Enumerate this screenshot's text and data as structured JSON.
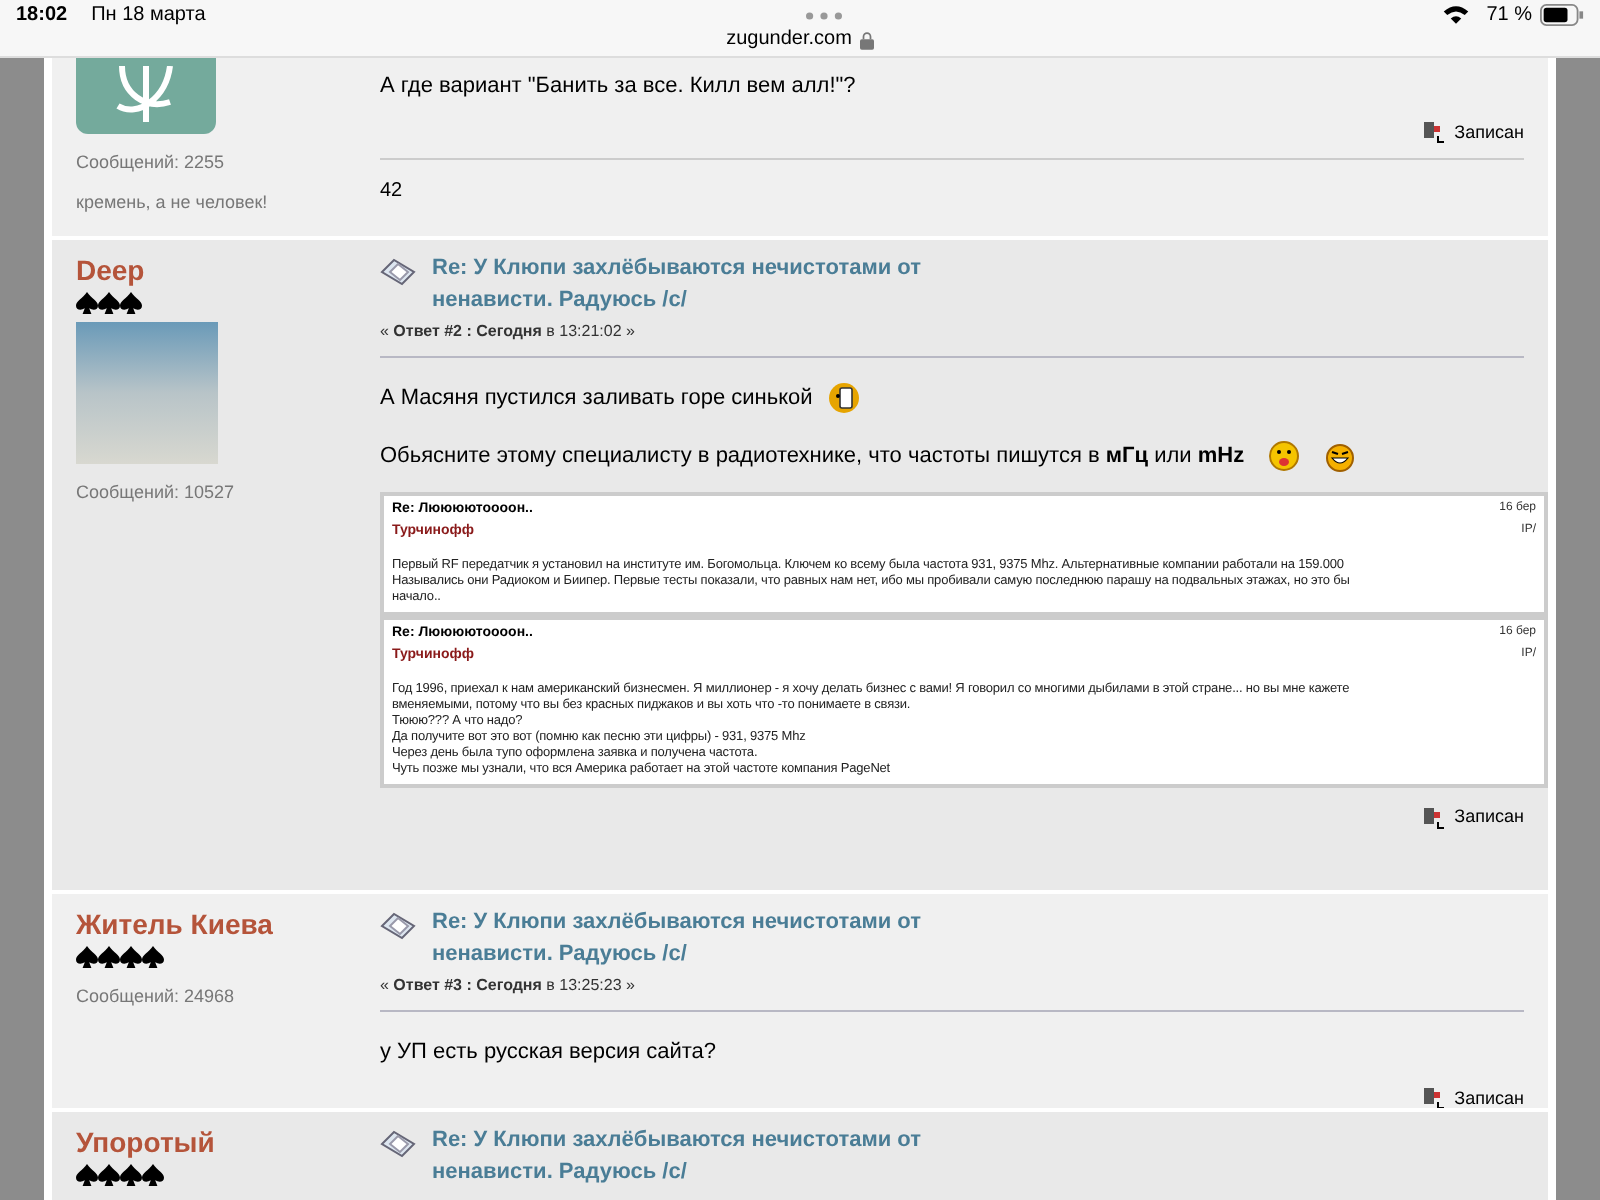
{
  "status_bar": {
    "time": "18:02",
    "date": "Пн 18 марта",
    "battery": "71 %"
  },
  "address_bar": {
    "url": "zugunder.com"
  },
  "posts": [
    {
      "avatar": {
        "kind": "logo"
      },
      "post_count": "Сообщений: 2255",
      "personal_text": "кремень, а не человек!",
      "body": [
        {
          "text": "А где вариант \"Банить за все. Килл вем алл!\"?"
        }
      ],
      "saved": "Записан",
      "signature": "42"
    },
    {
      "author": "Deep",
      "stars": 3,
      "avatar": {
        "kind": "album"
      },
      "post_count": "Сообщений: 10527",
      "title": "Re: У Клюпи захлёбываются нечистотами от ненависти. Радуюсь /с/",
      "reply_info": "« **Ответ #2 : Сегодня** в 13:21:02 »",
      "body": [
        {
          "text": "А Масяня пустился заливать горе синькой",
          "emoticons": [
            {
              "kind": "drinking"
            }
          ]
        },
        {
          "text": "Обьясните этому специалисту в радиотехнике, что частоты пишутся в **мГц** или **mHz**",
          "emoticons": [
            {
              "kind": "tongue"
            },
            {
              "kind": "grin"
            }
          ]
        }
      ],
      "quotes": [
        {
          "title": "Re: Люююютоооон..",
          "author": "Турчинофф",
          "date": "16 бер",
          "ip": "IP/",
          "lines": [
            "Первый RF передатчик я установил на институте им. Богомольца. Ключем ко всему была частота 931, 9375 Mhz. Альтернативные компании работали на 159.000",
            "Назывались они Радиоком и Биипер. Первые тесты показали, что равных нам нет, ибо мы пробивали самую последнюю парашу на подвальных этажах, но это бы",
            "начало.."
          ]
        },
        {
          "title": "Re: Люююютоооон..",
          "author": "Турчинофф",
          "date": "16 бер",
          "ip": "IP/",
          "lines": [
            "Год 1996, приехал к нам американский бизнесмен. Я миллионер - я хочу делать бизнес с вами! Я говорил со многими дыбилами в этой стране... но вы мне кажете",
            "вменяемыми, потому что вы без красных пиджаков и вы хоть что -то понимаете в связи.",
            "Тююю??? А что надо?",
            "Да получите вот это вот (помню как песню эти цифры) - 931, 9375 Mhz",
            "Через день была тупо оформлена заявка и получена частота.",
            "Чуть позже мы узнали, что вся Америка работает на этой частоте компания PageNet"
          ]
        }
      ],
      "saved": "Записан"
    },
    {
      "author": "Житель Киева",
      "stars": 4,
      "post_count": "Сообщений: 24968",
      "title": "Re: У Клюпи захлёбываются нечистотами от ненависти. Радуюсь /с/",
      "reply_info": "« **Ответ #3 : Сегодня** в 13:25:23 »",
      "body": [
        {
          "text": "у УП есть русская версия сайта?"
        }
      ],
      "saved": "Записан"
    },
    {
      "author": "Упоротый",
      "stars": 4,
      "title": "Re: У Клюпи захлёбываются нечистотами от ненависти. Радуюсь /с/"
    }
  ]
}
